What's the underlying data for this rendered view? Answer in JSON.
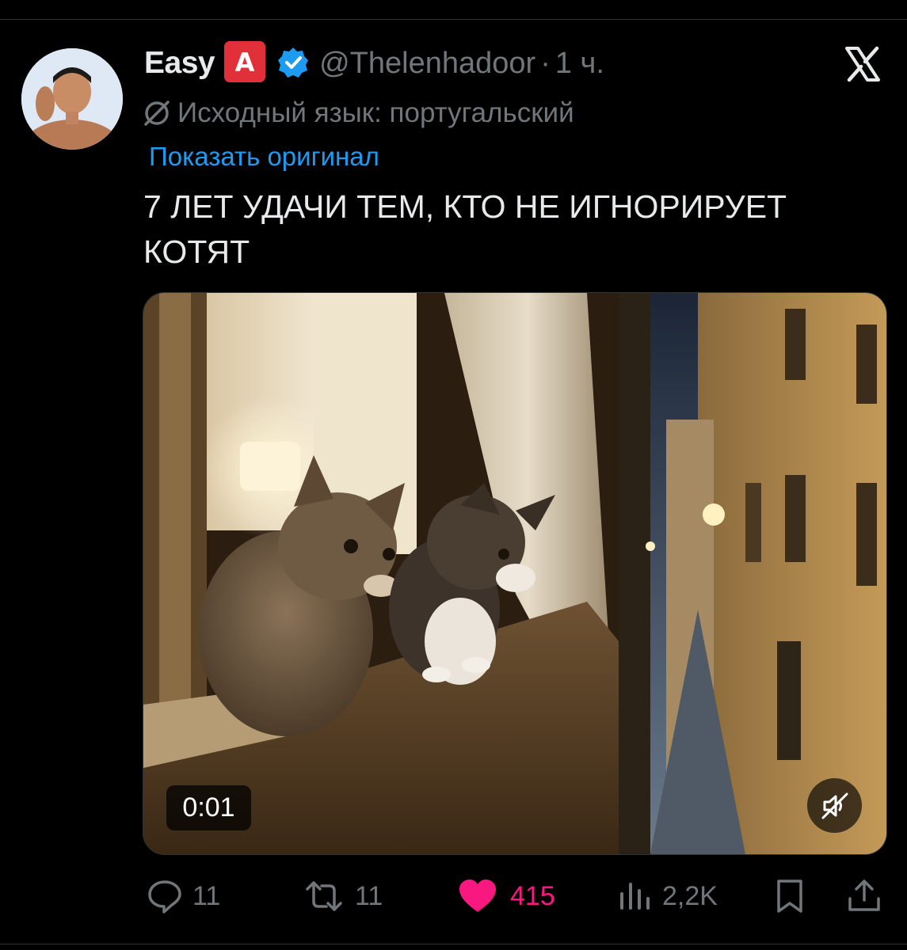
{
  "tweet": {
    "author_name": "Easy",
    "emoji_badge": "A",
    "handle": "@Thelenhadoor",
    "separator": "·",
    "time": "1 ч.",
    "translation_note": "Исходный язык: португальский",
    "show_original_link": "Показать оригинал",
    "text": "7 ЛЕТ УДАЧИ ТЕМ, КТО НЕ ИГНОРИРУЕТ КОТЯТ"
  },
  "media": {
    "type": "video",
    "timer": "0:01",
    "muted": true
  },
  "actions": {
    "replies": "11",
    "reposts": "11",
    "likes": "415",
    "views": "2,2K"
  },
  "colors": {
    "background": "#000000",
    "text_primary": "#e7e9ea",
    "text_secondary": "#71767b",
    "link": "#1d9bf0",
    "like": "#f91880",
    "badge_red": "#e1303a",
    "verified_blue": "#1d9bf0"
  },
  "icons": [
    "x-logo-icon",
    "verified-icon",
    "translate-icon",
    "reply-icon",
    "repost-icon",
    "heart-icon",
    "views-icon",
    "bookmark-icon",
    "share-icon",
    "mute-icon"
  ]
}
